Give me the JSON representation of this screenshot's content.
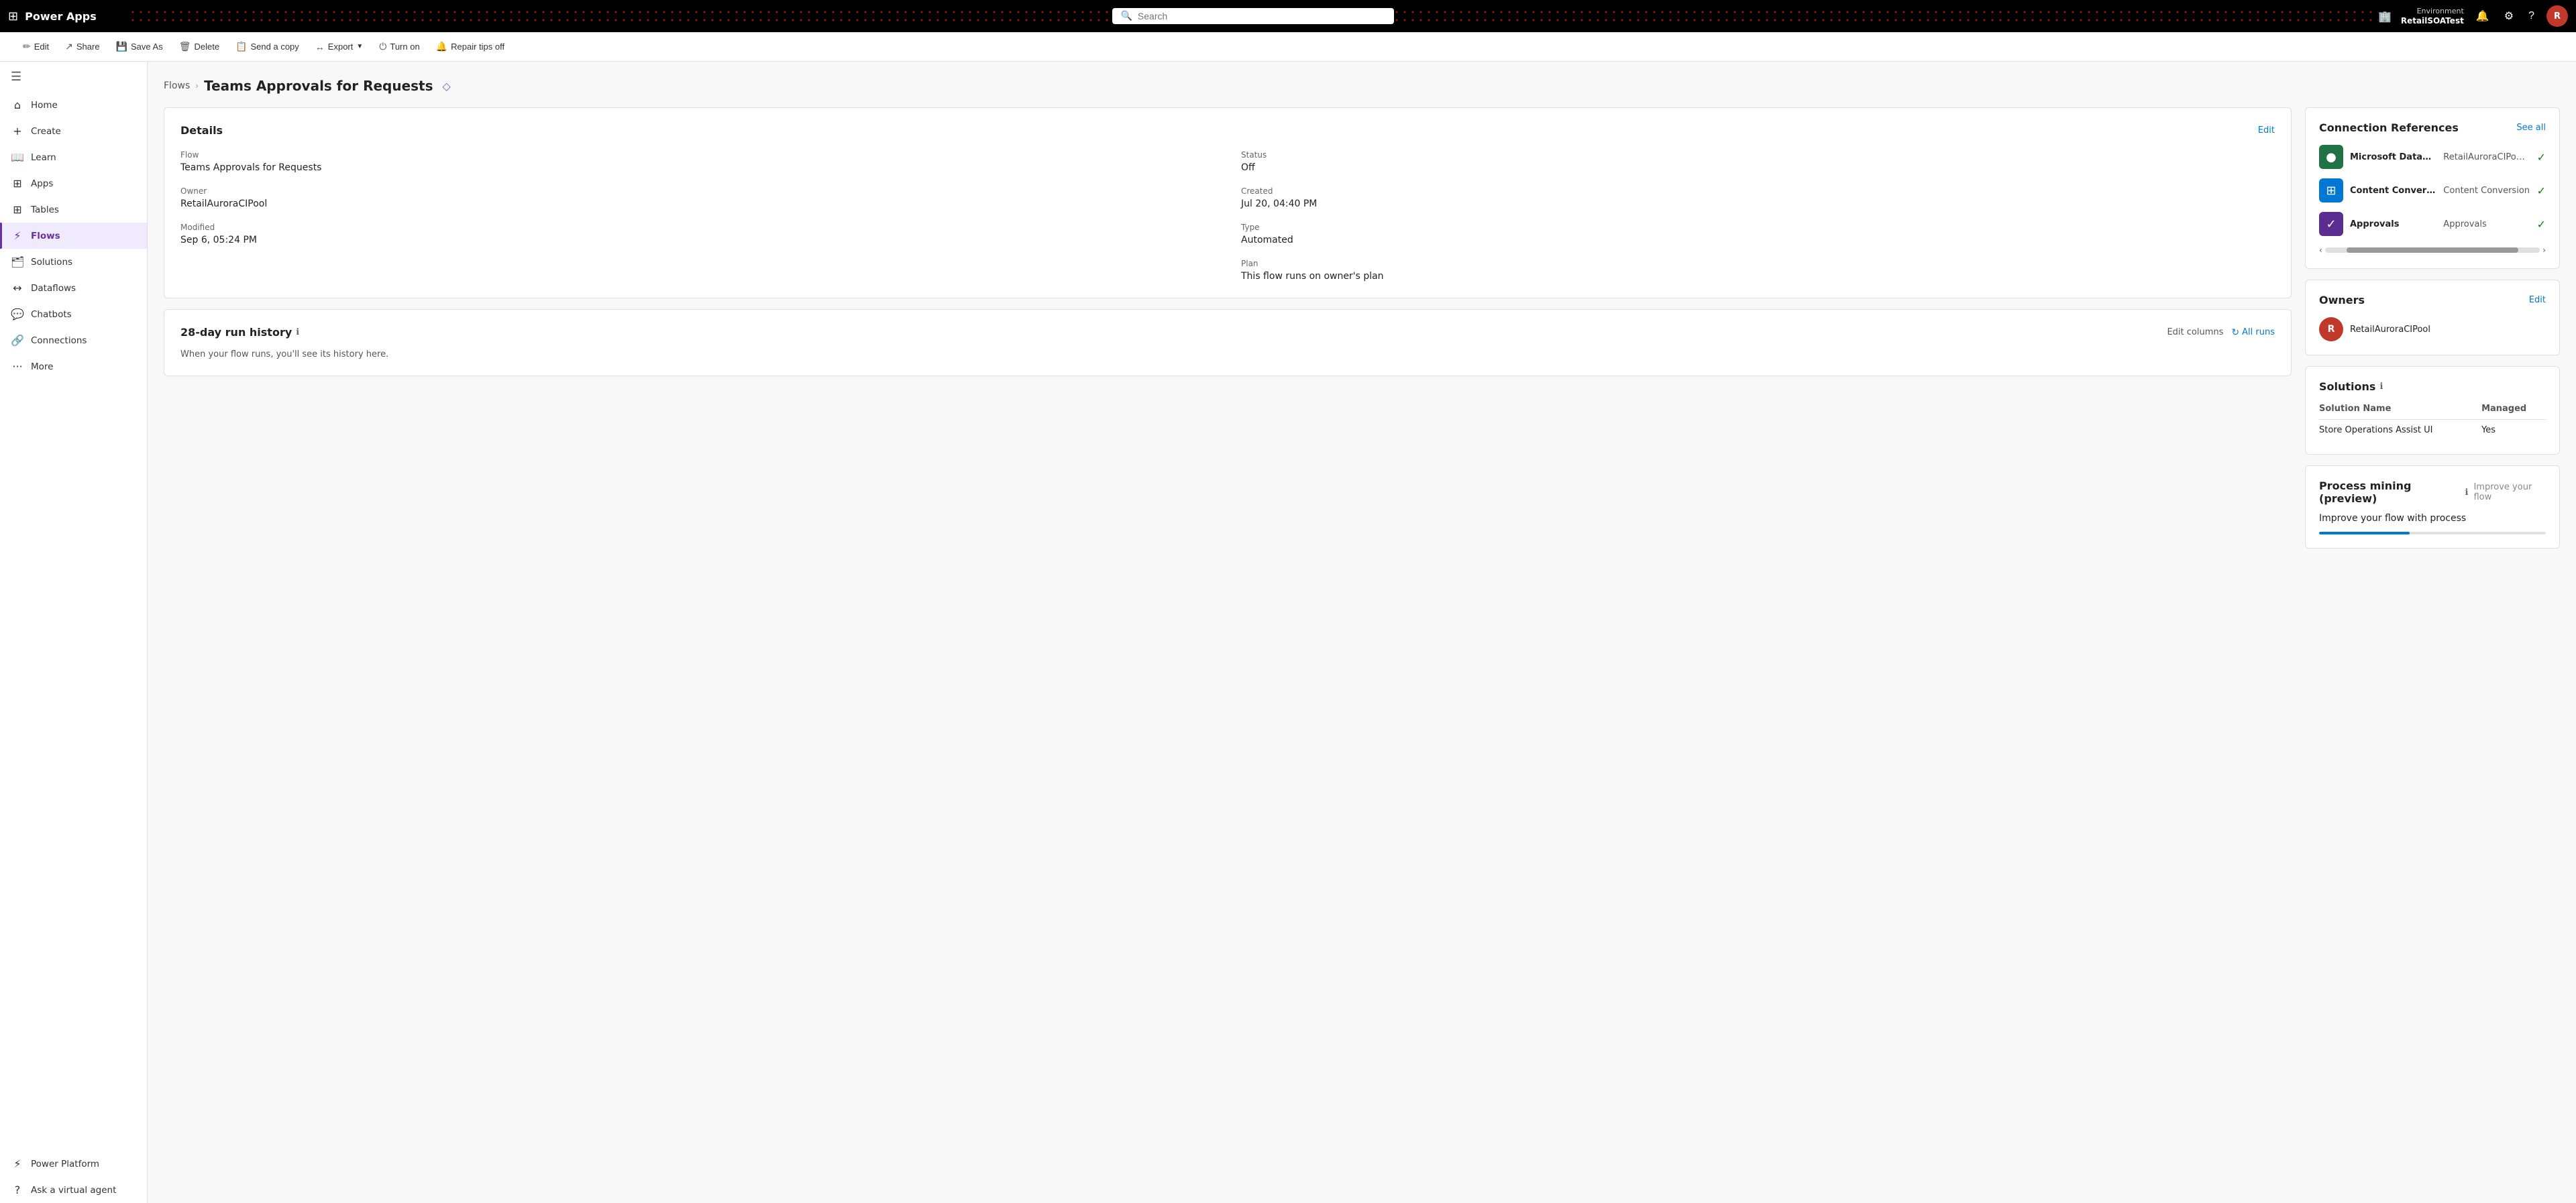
{
  "topnav": {
    "waffle_icon": "⊞",
    "app_title": "Power Apps",
    "search_placeholder": "Search",
    "env_label": "Environment",
    "env_name": "RetailSOATest",
    "avatar_letter": "R"
  },
  "toolbar": {
    "edit_label": "Edit",
    "share_label": "Share",
    "save_as_label": "Save As",
    "delete_label": "Delete",
    "send_copy_label": "Send a copy",
    "export_label": "Export",
    "turn_on_label": "Turn on",
    "repair_tips_label": "Repair tips off"
  },
  "sidebar": {
    "collapse_icon": "☰",
    "items": [
      {
        "id": "home",
        "icon": "⌂",
        "label": "Home"
      },
      {
        "id": "create",
        "icon": "+",
        "label": "Create"
      },
      {
        "id": "learn",
        "icon": "📖",
        "label": "Learn"
      },
      {
        "id": "apps",
        "icon": "⊞",
        "label": "Apps"
      },
      {
        "id": "tables",
        "icon": "⊞",
        "label": "Tables"
      },
      {
        "id": "flows",
        "icon": "⚡",
        "label": "Flows"
      },
      {
        "id": "solutions",
        "icon": "🗂",
        "label": "Solutions"
      },
      {
        "id": "dataflows",
        "icon": "↔",
        "label": "Dataflows"
      },
      {
        "id": "chatbots",
        "icon": "💬",
        "label": "Chatbots"
      },
      {
        "id": "connections",
        "icon": "🔗",
        "label": "Connections"
      },
      {
        "id": "more",
        "icon": "···",
        "label": "More"
      }
    ],
    "bottom_item": {
      "id": "ask-virtual-agent",
      "icon": "?",
      "label": "Ask a virtual agent"
    },
    "power_platform": {
      "id": "power-platform",
      "icon": "⚡",
      "label": "Power Platform"
    }
  },
  "breadcrumb": {
    "parent_label": "Flows",
    "chevron": "›",
    "current_label": "Teams Approvals for Requests",
    "premium_icon": "◇"
  },
  "details_card": {
    "title": "Details",
    "edit_link": "Edit",
    "flow_label": "Flow",
    "flow_value": "Teams Approvals for Requests",
    "status_label": "Status",
    "status_value": "Off",
    "owner_label": "Owner",
    "owner_value": "RetailAuroraCIPool",
    "created_label": "Created",
    "created_value": "Jul 20, 04:40 PM",
    "modified_label": "Modified",
    "modified_value": "Sep 6, 05:24 PM",
    "type_label": "Type",
    "type_value": "Automated",
    "plan_label": "Plan",
    "plan_value": "This flow runs on owner's plan"
  },
  "run_history": {
    "title": "28-day run history",
    "info_icon": "ℹ",
    "edit_columns_label": "Edit columns",
    "all_runs_label": "All runs",
    "refresh_icon": "↻",
    "empty_message": "When your flow runs, you'll see its history here."
  },
  "connection_references": {
    "title": "Connection References",
    "see_all_label": "See all",
    "connections": [
      {
        "icon": "●",
        "icon_color": "green",
        "name": "Microsoft Datave…",
        "detail": "RetailAuroraCIPool@RetailCP…",
        "status": "✓"
      },
      {
        "icon": "⊞",
        "icon_color": "blue",
        "name": "Content Conversi…",
        "detail": "Content Conversion",
        "status": "✓"
      },
      {
        "icon": "✓",
        "icon_color": "purple",
        "name": "Approvals",
        "detail": "Approvals",
        "status": "✓"
      }
    ]
  },
  "owners": {
    "title": "Owners",
    "edit_link": "Edit",
    "owner": {
      "avatar_letter": "R",
      "name": "RetailAuroraCIPool"
    }
  },
  "solutions": {
    "title": "Solutions",
    "info_icon": "ℹ",
    "col_name": "Solution Name",
    "col_managed": "Managed",
    "rows": [
      {
        "name": "Store Operations Assist UI",
        "managed": "Yes"
      }
    ]
  },
  "process_mining": {
    "title": "Process mining (preview)",
    "info_icon": "ℹ",
    "improve_link": "Improve your flow",
    "content": "Improve your flow with process"
  }
}
